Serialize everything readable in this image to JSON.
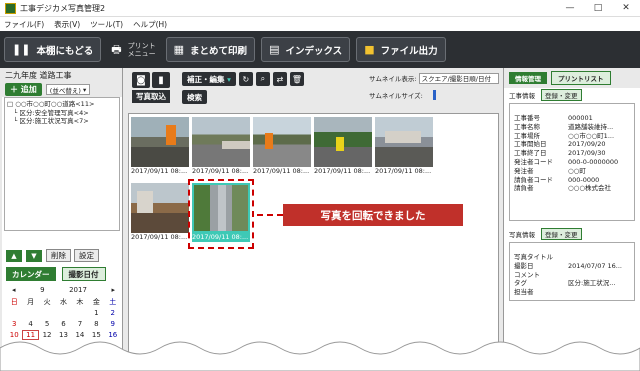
{
  "window": {
    "title": "工事デジカメ写真管理2",
    "minimize": "—",
    "maximize": "□",
    "close": "✕"
  },
  "menu": [
    "ファイル(F)",
    "表示(V)",
    "ツール(T)",
    "ヘルプ(H)"
  ],
  "toolbar": {
    "back": "本棚にもどる",
    "print_menu": "プリント\nメニュー",
    "batch_print": "まとめて印刷",
    "index": "インデックス",
    "file_output": "ファイル出力"
  },
  "left": {
    "title": "二九年度 道路工事",
    "add": "追加",
    "sort": "(並べ替え)",
    "tree": [
      "□ ○○市○○町○○道路<11>",
      "　└ 区分:安全管理写真<4>",
      "　└ 区分:施工状況写真<7>"
    ],
    "delete": "削除",
    "settings": "設定",
    "calendar_tab": "カレンダー",
    "date_tab": "撮影日付",
    "calendar": {
      "month": "9",
      "year": "2017",
      "days": [
        "日",
        "月",
        "火",
        "水",
        "木",
        "金",
        "土"
      ],
      "weeks": [
        [
          "",
          "",
          "",
          "",
          "",
          "1",
          "2"
        ],
        [
          "3",
          "4",
          "5",
          "6",
          "7",
          "8",
          "9"
        ],
        [
          "10",
          "11",
          "12",
          "13",
          "14",
          "15",
          "16"
        ]
      ],
      "today": "11"
    }
  },
  "center": {
    "camera_label": "写真取込",
    "edit": "補正・編集",
    "search": "検索",
    "thumb_display_label": "サムネイル表示:",
    "thumb_display_value": "スクエア/撮影日順/日付",
    "thumb_size_label": "サムネイルサイズ:",
    "photos": [
      {
        "caption": "2017/09/11 08:...",
        "style": "a"
      },
      {
        "caption": "2017/09/11 08:...",
        "style": "b"
      },
      {
        "caption": "2017/09/11 08:...",
        "style": "c"
      },
      {
        "caption": "2017/09/11 08:...",
        "style": "d"
      },
      {
        "caption": "2017/09/11 08:...",
        "style": "e"
      },
      {
        "caption": "2017/09/11 08:...",
        "style": "f"
      },
      {
        "caption": "2017/09/11 08:...",
        "style": "g"
      }
    ],
    "callout": "写真を回転できました"
  },
  "right": {
    "tab_info": "情報管理",
    "tab_print": "プリントリスト",
    "work_info": "工事情報",
    "register_change": "登録・変更",
    "work_rows": [
      {
        "k": "工事番号",
        "v": "000001"
      },
      {
        "k": "工事名称",
        "v": "道路舗装維持..."
      },
      {
        "k": "工事場所",
        "v": "○○市○○町1..."
      },
      {
        "k": "工事開始日",
        "v": "2017/09/20"
      },
      {
        "k": "工事終了日",
        "v": "2017/09/30"
      },
      {
        "k": "発注者コード",
        "v": "000-0-0000000"
      },
      {
        "k": "発注者",
        "v": "○○町"
      },
      {
        "k": "請負者コード",
        "v": "000-0000"
      },
      {
        "k": "請負者",
        "v": "○○○株式会社"
      }
    ],
    "photo_info": "写真情報",
    "photo_rows": [
      {
        "k": "写真タイトル",
        "v": ""
      },
      {
        "k": "撮影日",
        "v": "2014/07/07 16..."
      },
      {
        "k": "コメント",
        "v": ""
      },
      {
        "k": "タグ",
        "v": "区分:施工状況..."
      },
      {
        "k": "担当者",
        "v": ""
      }
    ]
  }
}
